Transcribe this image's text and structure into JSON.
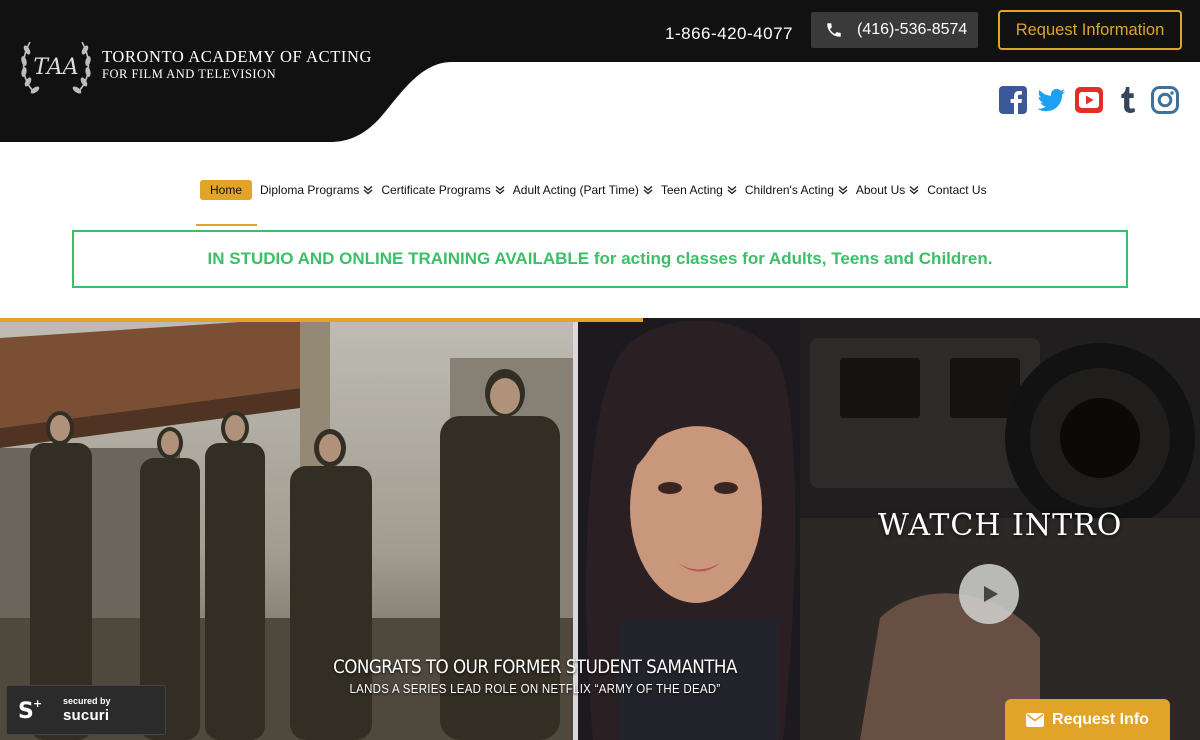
{
  "brand": {
    "logo_letters": "TAA",
    "name_line1": "TORONTO ACADEMY OF ACTING",
    "name_line2": "FOR FILM AND TELEVISION"
  },
  "header": {
    "phone_tollfree": "1-866-420-4077",
    "phone_local": "(416)-536-8574",
    "request_button": "Request Information"
  },
  "social": [
    "facebook-icon",
    "twitter-icon",
    "youtube-icon",
    "tumblr-icon",
    "instagram-icon"
  ],
  "nav": {
    "items": [
      {
        "label": "Home",
        "active": true,
        "has_dropdown": false
      },
      {
        "label": "Diploma Programs",
        "has_dropdown": true
      },
      {
        "label": "Certificate Programs",
        "has_dropdown": true
      },
      {
        "label": "Adult Acting (Part Time)",
        "has_dropdown": true
      },
      {
        "label": "Teen Acting",
        "has_dropdown": true
      },
      {
        "label": "Children's Acting",
        "has_dropdown": true
      },
      {
        "label": "About Us",
        "has_dropdown": true
      },
      {
        "label": "Contact Us",
        "has_dropdown": false
      }
    ]
  },
  "notice": {
    "text": "IN STUDIO AND ONLINE TRAINING AVAILABLE for acting classes for Adults, Teens and Children."
  },
  "hero": {
    "slide_title": "CONGRATS TO OUR FORMER STUDENT SAMANTHA",
    "slide_subtitle": "LANDS A SERIES LEAD ROLE ON NETFLIX “ARMY OF THE DEAD”",
    "watch_intro": "WATCH INTRO"
  },
  "sucuri": {
    "small": "secured by",
    "brand": "sucuri"
  },
  "floating_request": {
    "label": "Request Info"
  },
  "colors": {
    "gold": "#e1a429",
    "green": "#3cc067",
    "header_black": "#111111"
  }
}
